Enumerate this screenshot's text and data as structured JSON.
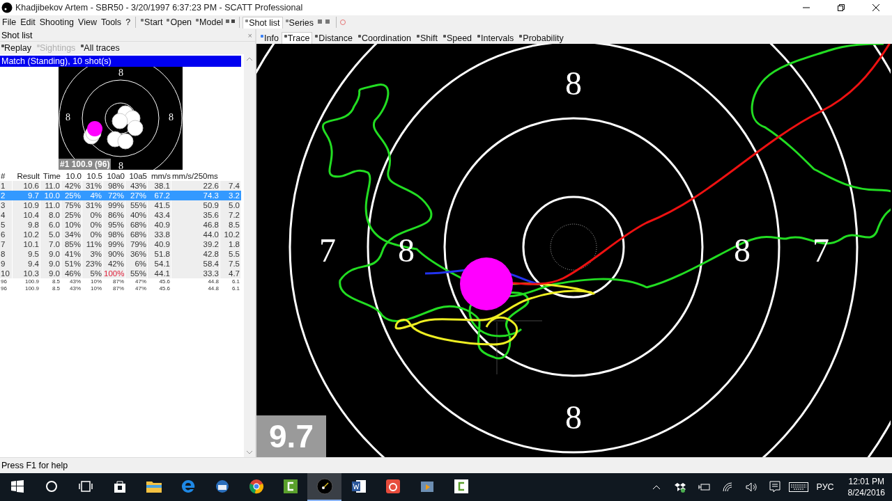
{
  "window": {
    "title": "Khadjibekov Artem - SBR50 - 3/20/1997 6:37:23 PM - SCATT Professional"
  },
  "menu": [
    "File",
    "Edit",
    "Shooting",
    "View",
    "Tools",
    "?"
  ],
  "toolbar": [
    "Start",
    "Open",
    "Model"
  ],
  "view_tabs": [
    {
      "label": "Shot list",
      "selected": true
    },
    {
      "label": "Series",
      "selected": false
    }
  ],
  "shot_list": {
    "title": "Shot list",
    "close": "×",
    "actions": [
      {
        "label": "Replay",
        "disabled": false
      },
      {
        "label": "Sightings",
        "disabled": true
      },
      {
        "label": "All traces",
        "disabled": false
      }
    ],
    "group": {
      "label": "Match (Standing), 10 shot(s)",
      "selected": true
    },
    "thumbnail": {
      "ring_labels": [
        "8",
        "8",
        "8",
        "8"
      ],
      "caption": "#1 100.9 (96)"
    },
    "columns": [
      "#",
      "Result",
      "Time",
      "10.0",
      "10.5",
      "10a0",
      "10a5",
      "mm/s",
      "mm/s/250ms"
    ],
    "rows": [
      {
        "kind": "shot",
        "selected": false,
        "cells": [
          {
            "text": "1",
            "alert": false
          },
          {
            "text": "10.6",
            "alert": false
          },
          {
            "text": "11.0",
            "alert": false
          },
          {
            "text": "42%",
            "alert": false
          },
          {
            "text": "31%",
            "alert": false
          },
          {
            "text": "98%",
            "alert": false
          },
          {
            "text": "43%",
            "alert": false
          },
          {
            "text": "38.1",
            "alert": false
          },
          {
            "text": "22.6",
            "alert": false
          },
          {
            "text": "7.4",
            "alert": false
          }
        ]
      },
      {
        "kind": "shot",
        "selected": true,
        "cells": [
          {
            "text": "2",
            "alert": false
          },
          {
            "text": "9.7",
            "alert": false
          },
          {
            "text": "10.0",
            "alert": false
          },
          {
            "text": "25%",
            "alert": false
          },
          {
            "text": "4%",
            "alert": false
          },
          {
            "text": "72%",
            "alert": false
          },
          {
            "text": "27%",
            "alert": false
          },
          {
            "text": "67.2",
            "alert": false
          },
          {
            "text": "74.3",
            "alert": false
          },
          {
            "text": "3.2",
            "alert": false
          }
        ]
      },
      {
        "kind": "shot",
        "selected": false,
        "cells": [
          {
            "text": "3",
            "alert": false
          },
          {
            "text": "10.9",
            "alert": false
          },
          {
            "text": "11.0",
            "alert": false
          },
          {
            "text": "75%",
            "alert": false
          },
          {
            "text": "31%",
            "alert": false
          },
          {
            "text": "99%",
            "alert": false
          },
          {
            "text": "55%",
            "alert": false
          },
          {
            "text": "41.5",
            "alert": false
          },
          {
            "text": "50.9",
            "alert": false
          },
          {
            "text": "5.0",
            "alert": false
          }
        ]
      },
      {
        "kind": "shot",
        "selected": false,
        "cells": [
          {
            "text": "4",
            "alert": false
          },
          {
            "text": "10.4",
            "alert": false
          },
          {
            "text": "8.0",
            "alert": false
          },
          {
            "text": "25%",
            "alert": false
          },
          {
            "text": "0%",
            "alert": false
          },
          {
            "text": "86%",
            "alert": false
          },
          {
            "text": "40%",
            "alert": false
          },
          {
            "text": "43.4",
            "alert": false
          },
          {
            "text": "35.6",
            "alert": false
          },
          {
            "text": "7.2",
            "alert": false
          }
        ]
      },
      {
        "kind": "shot",
        "selected": false,
        "cells": [
          {
            "text": "5",
            "alert": false
          },
          {
            "text": "9.8",
            "alert": false
          },
          {
            "text": "6.0",
            "alert": false
          },
          {
            "text": "10%",
            "alert": false
          },
          {
            "text": "0%",
            "alert": false
          },
          {
            "text": "95%",
            "alert": false
          },
          {
            "text": "68%",
            "alert": false
          },
          {
            "text": "40.9",
            "alert": false
          },
          {
            "text": "46.8",
            "alert": false
          },
          {
            "text": "8.5",
            "alert": false
          }
        ]
      },
      {
        "kind": "shot",
        "selected": false,
        "cells": [
          {
            "text": "6",
            "alert": false
          },
          {
            "text": "10.2",
            "alert": false
          },
          {
            "text": "5.0",
            "alert": false
          },
          {
            "text": "34%",
            "alert": false
          },
          {
            "text": "0%",
            "alert": false
          },
          {
            "text": "98%",
            "alert": false
          },
          {
            "text": "68%",
            "alert": false
          },
          {
            "text": "33.8",
            "alert": false
          },
          {
            "text": "44.0",
            "alert": false
          },
          {
            "text": "10.2",
            "alert": false
          }
        ]
      },
      {
        "kind": "shot",
        "selected": false,
        "cells": [
          {
            "text": "7",
            "alert": false
          },
          {
            "text": "10.1",
            "alert": false
          },
          {
            "text": "7.0",
            "alert": false
          },
          {
            "text": "85%",
            "alert": false
          },
          {
            "text": "11%",
            "alert": false
          },
          {
            "text": "99%",
            "alert": false
          },
          {
            "text": "79%",
            "alert": false
          },
          {
            "text": "40.9",
            "alert": false
          },
          {
            "text": "39.2",
            "alert": false
          },
          {
            "text": "1.8",
            "alert": false
          }
        ]
      },
      {
        "kind": "shot",
        "selected": false,
        "cells": [
          {
            "text": "8",
            "alert": false
          },
          {
            "text": "9.5",
            "alert": false
          },
          {
            "text": "9.0",
            "alert": false
          },
          {
            "text": "41%",
            "alert": false
          },
          {
            "text": "3%",
            "alert": false
          },
          {
            "text": "90%",
            "alert": false
          },
          {
            "text": "36%",
            "alert": false
          },
          {
            "text": "51.8",
            "alert": false
          },
          {
            "text": "42.8",
            "alert": false
          },
          {
            "text": "5.5",
            "alert": false
          }
        ]
      },
      {
        "kind": "shot",
        "selected": false,
        "cells": [
          {
            "text": "9",
            "alert": false
          },
          {
            "text": "9.4",
            "alert": false
          },
          {
            "text": "9.0",
            "alert": false
          },
          {
            "text": "51%",
            "alert": false
          },
          {
            "text": "23%",
            "alert": false
          },
          {
            "text": "42%",
            "alert": false
          },
          {
            "text": "6%",
            "alert": false
          },
          {
            "text": "54.1",
            "alert": false
          },
          {
            "text": "58.4",
            "alert": false
          },
          {
            "text": "7.5",
            "alert": false
          }
        ]
      },
      {
        "kind": "shot",
        "selected": false,
        "cells": [
          {
            "text": "10",
            "alert": false
          },
          {
            "text": "10.3",
            "alert": false
          },
          {
            "text": "9.0",
            "alert": false
          },
          {
            "text": "46%",
            "alert": false
          },
          {
            "text": "5%",
            "alert": false
          },
          {
            "text": "100%",
            "alert": true
          },
          {
            "text": "55%",
            "alert": false
          },
          {
            "text": "44.1",
            "alert": false
          },
          {
            "text": "33.3",
            "alert": false
          },
          {
            "text": "4.7",
            "alert": false
          }
        ]
      },
      {
        "kind": "summary",
        "selected": false,
        "cells": [
          {
            "text": "96",
            "alert": false
          },
          {
            "text": "100.9",
            "alert": false
          },
          {
            "text": "8.5",
            "alert": false
          },
          {
            "text": "43%",
            "alert": false
          },
          {
            "text": "10%",
            "alert": false
          },
          {
            "text": "87%",
            "alert": false
          },
          {
            "text": "47%",
            "alert": false
          },
          {
            "text": "45.6",
            "alert": false
          },
          {
            "text": "44.8",
            "alert": false
          },
          {
            "text": "6.1",
            "alert": false
          }
        ]
      },
      {
        "kind": "summary",
        "selected": false,
        "cells": [
          {
            "text": "96",
            "alert": false
          },
          {
            "text": "100.9",
            "alert": false
          },
          {
            "text": "8.5",
            "alert": false
          },
          {
            "text": "43%",
            "alert": false
          },
          {
            "text": "10%",
            "alert": false
          },
          {
            "text": "87%",
            "alert": false
          },
          {
            "text": "47%",
            "alert": false
          },
          {
            "text": "45.6",
            "alert": false
          },
          {
            "text": "44.8",
            "alert": false
          },
          {
            "text": "6.1",
            "alert": false
          }
        ]
      }
    ]
  },
  "analysis_tabs": [
    {
      "label": "Info",
      "selected": false
    },
    {
      "label": "Trace",
      "selected": true
    },
    {
      "label": "Distance",
      "selected": false
    },
    {
      "label": "Coordination",
      "selected": false
    },
    {
      "label": "Shift",
      "selected": false
    },
    {
      "label": "Speed",
      "selected": false
    },
    {
      "label": "Intervals",
      "selected": false
    },
    {
      "label": "Probability",
      "selected": false
    }
  ],
  "target": {
    "ring_labels": [
      "8",
      "8",
      "8",
      "8",
      "7",
      "7"
    ],
    "score": "9.7"
  },
  "status_bar": "Press F1 for help",
  "taskbar": {
    "apps": [
      {
        "kind": "explorer",
        "selected": false
      },
      {
        "kind": "edge",
        "selected": false
      },
      {
        "kind": "mail",
        "selected": false
      },
      {
        "kind": "chrome",
        "selected": false
      },
      {
        "kind": "camtasia",
        "selected": false
      },
      {
        "kind": "scatt",
        "selected": true
      },
      {
        "kind": "word",
        "selected": false
      },
      {
        "kind": "camera",
        "selected": false
      },
      {
        "kind": "player",
        "selected": false
      },
      {
        "kind": "recorder",
        "selected": false
      }
    ],
    "language": "РУС",
    "time": "12:01 PM",
    "date": "8/24/2016"
  }
}
